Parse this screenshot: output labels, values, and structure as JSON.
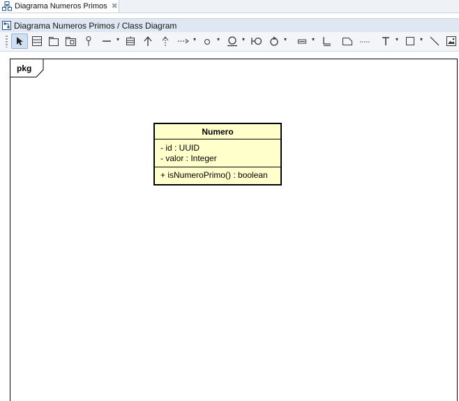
{
  "tab": {
    "label": "Diagrama Numeros Primos",
    "close_symbol": "✖"
  },
  "title": "Diagrama Numeros Primos / Class Diagram",
  "toolbar": {
    "tools": [
      "select-tool",
      "class-tool",
      "package-tool",
      "package-with-class-tool",
      "interface-tool",
      "association-tool",
      "generalization-tool",
      "realization-tool",
      "dependency-tool",
      "node-tool",
      "component-tool",
      "provided-interface-tool",
      "required-interface-tool",
      "note-tool",
      "text-tool",
      "rectangle-tool",
      "line-tool",
      "image-tool"
    ],
    "dropdown_symbol": "▾"
  },
  "diagram": {
    "package_label": "pkg",
    "class": {
      "name": "Numero",
      "attributes": [
        "- id : UUID",
        "- valor : Integer"
      ],
      "operations": [
        "+ isNumeroPrimo() : boolean"
      ]
    }
  },
  "colors": {
    "class_fill": "#ffffcc",
    "title_bar": "#dfe8f2",
    "toolbar": "#f3f5f8",
    "tab_strip": "#eef2f7"
  }
}
